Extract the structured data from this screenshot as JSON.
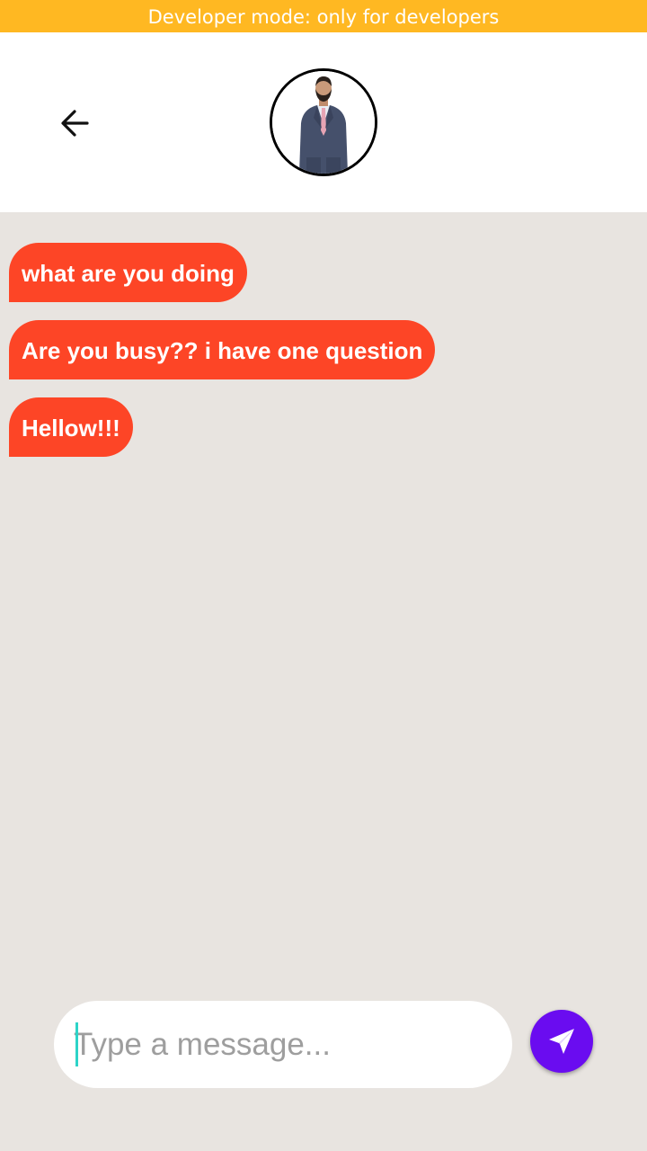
{
  "banner": {
    "text": "Developer mode: only for developers",
    "color": "#ffb822"
  },
  "header": {
    "back_icon": "arrow-left-icon",
    "avatar": "contact-avatar-photo"
  },
  "messages": [
    {
      "text": "what are you doing"
    },
    {
      "text": "Are you busy?? i have one question"
    },
    {
      "text": "Hellow!!!"
    }
  ],
  "composer": {
    "placeholder": "Type a message...",
    "value": "",
    "send_icon": "paper-plane-icon"
  },
  "colors": {
    "chat_background": "#e8e4e0",
    "bubble": "#fd4526",
    "send_button": "#6a0cf0"
  }
}
